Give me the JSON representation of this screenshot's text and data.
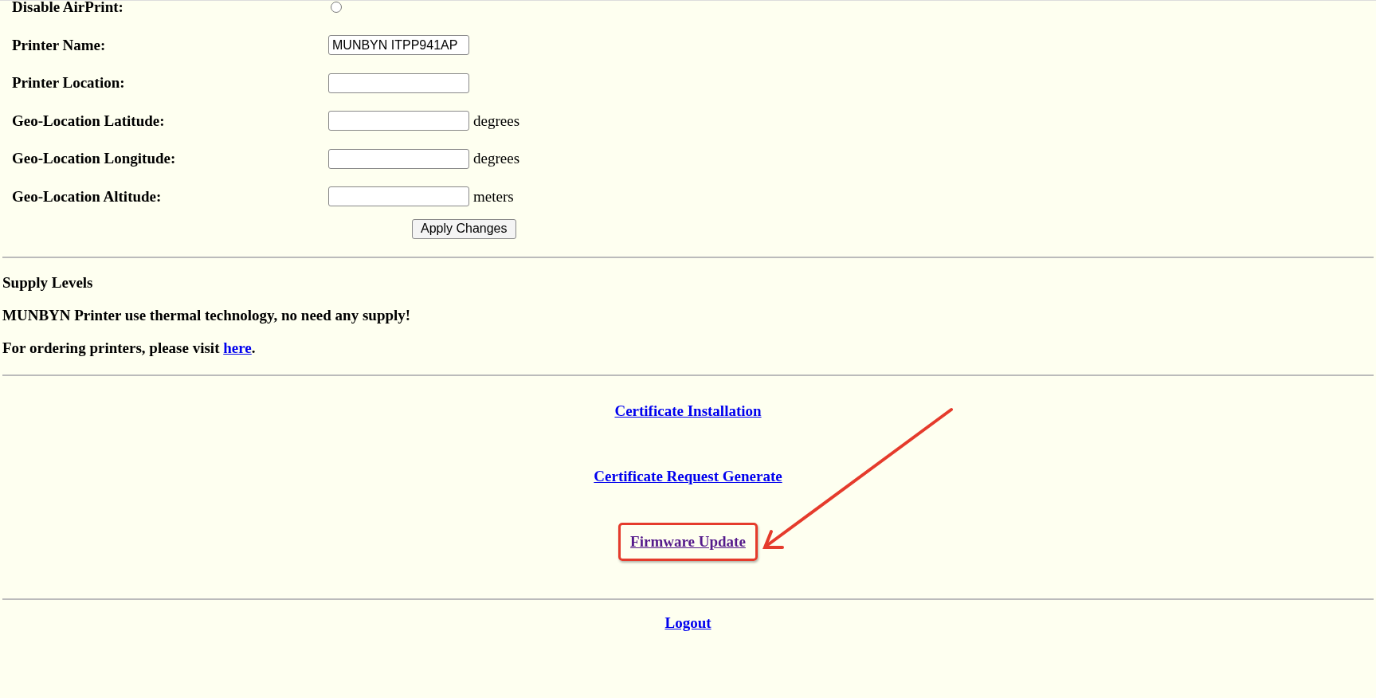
{
  "form": {
    "rows": [
      {
        "kind": "radio",
        "label": "Disable AirPrint:",
        "checked": false
      },
      {
        "kind": "text",
        "label": "Printer Name:",
        "value": "MUNBYN ITPP941AP"
      },
      {
        "kind": "text",
        "label": "Printer Location:",
        "value": ""
      },
      {
        "kind": "text",
        "label": "Geo-Location Latitude:",
        "value": "",
        "unit": "degrees"
      },
      {
        "kind": "text",
        "label": "Geo-Location Longitude:",
        "value": "",
        "unit": "degrees"
      },
      {
        "kind": "text",
        "label": "Geo-Location Altitude:",
        "value": "",
        "unit": "meters"
      }
    ],
    "apply_button": "Apply Changes"
  },
  "supply": {
    "heading": "Supply Levels",
    "note": "MUNBYN Printer use thermal technology, no need any supply!",
    "order_text": "For ordering printers, please visit",
    "order_link": "here",
    "order_end": "."
  },
  "links": [
    {
      "label": "Certificate Installation",
      "visited": false,
      "highlighted": false
    },
    {
      "label": "Certificate Request Generate",
      "visited": false,
      "highlighted": false
    },
    {
      "label": "Firmware Update",
      "visited": true,
      "highlighted": true
    }
  ],
  "logout": "Logout"
}
